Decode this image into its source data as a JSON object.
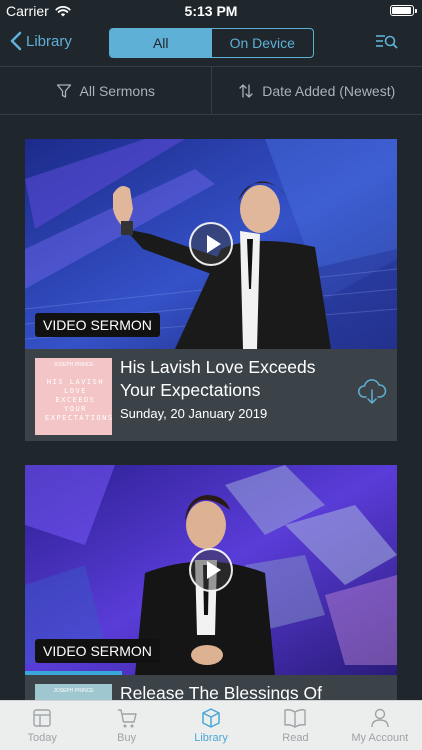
{
  "status": {
    "carrier": "Carrier",
    "time": "5:13 PM"
  },
  "nav": {
    "back_label": "Library",
    "segments": [
      "All",
      "On Device"
    ],
    "active_segment": "All"
  },
  "filters": {
    "filter_label": "All Sermons",
    "sort_label": "Date Added (Newest)"
  },
  "cards": [
    {
      "badge": "VIDEO SERMON",
      "title": "His Lavish Love Exceeds Your Expectations",
      "date": "Sunday, 20 January 2019",
      "thumb_title": "HIS LAVISH LOVE EXCEEDS YOUR EXPECTATIONS",
      "thumb_author": "JOSEPH PRINCE",
      "action_icon": "cloud-download-icon"
    },
    {
      "badge": "VIDEO SERMON",
      "title": "Release The Blessings Of",
      "thumb_author": "JOSEPH PRINCE",
      "progress": 0.26
    }
  ],
  "tabs": [
    {
      "label": "Today",
      "icon": "today-icon"
    },
    {
      "label": "Buy",
      "icon": "cart-icon"
    },
    {
      "label": "Library",
      "icon": "library-icon",
      "active": true
    },
    {
      "label": "Read",
      "icon": "book-icon"
    },
    {
      "label": "My Account",
      "icon": "account-icon"
    }
  ],
  "colors": {
    "accent": "#5fb0d6",
    "background": "#1f262c",
    "card": "#3b4349",
    "tab_active": "#4aa8d5"
  }
}
